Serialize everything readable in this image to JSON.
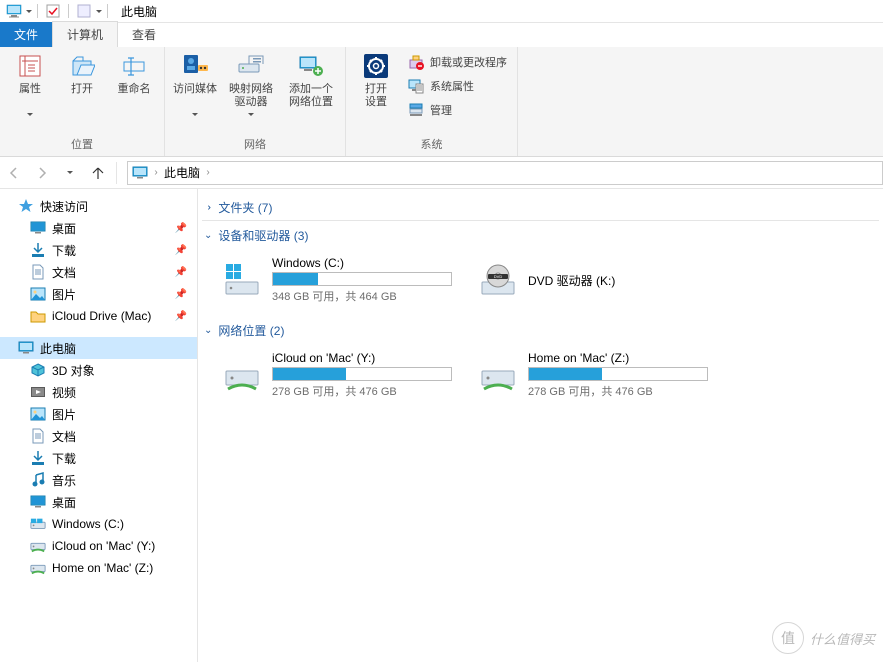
{
  "title": "此电脑",
  "tabs": {
    "file": "文件",
    "computer": "计算机",
    "view": "查看"
  },
  "ribbon": {
    "location": {
      "label": "位置",
      "properties": "属性",
      "open": "打开",
      "rename": "重命名"
    },
    "network": {
      "label": "网络",
      "accessMedia": "访问媒体",
      "mapDrive": "映射网络\n驱动器",
      "addLocation": "添加一个\n网络位置"
    },
    "system": {
      "label": "系统",
      "openSettings": "打开\n设置",
      "uninstall": "卸载或更改程序",
      "sysProps": "系统属性",
      "manage": "管理"
    }
  },
  "breadcrumb": {
    "root": "此电脑"
  },
  "nav": {
    "quickAccess": "快速访问",
    "pinned": [
      {
        "label": "桌面",
        "icon": "desktop"
      },
      {
        "label": "下载",
        "icon": "download"
      },
      {
        "label": "文档",
        "icon": "document"
      },
      {
        "label": "图片",
        "icon": "picture"
      },
      {
        "label": "iCloud Drive (Mac)",
        "icon": "folder"
      }
    ],
    "thisPC": "此电脑",
    "pcItems": [
      {
        "label": "3D 对象",
        "icon": "3d"
      },
      {
        "label": "视频",
        "icon": "video"
      },
      {
        "label": "图片",
        "icon": "picture"
      },
      {
        "label": "文档",
        "icon": "document"
      },
      {
        "label": "下载",
        "icon": "download"
      },
      {
        "label": "音乐",
        "icon": "music"
      },
      {
        "label": "桌面",
        "icon": "desktop"
      },
      {
        "label": "Windows (C:)",
        "icon": "drive"
      },
      {
        "label": "iCloud on 'Mac' (Y:)",
        "icon": "netdrive"
      },
      {
        "label": "Home on 'Mac' (Z:)",
        "icon": "netdrive"
      }
    ]
  },
  "content": {
    "folders": {
      "label": "文件夹",
      "count": 7
    },
    "devices": {
      "label": "设备和驱动器",
      "count": 3,
      "items": [
        {
          "name": "Windows (C:)",
          "icon": "osdrive",
          "used": 25,
          "sub": "348 GB 可用，共 464 GB"
        },
        {
          "name": "DVD 驱动器 (K:)",
          "icon": "dvd",
          "noBar": true
        }
      ]
    },
    "netloc": {
      "label": "网络位置",
      "count": 2,
      "items": [
        {
          "name": "iCloud on 'Mac' (Y:)",
          "icon": "netdrive",
          "used": 41,
          "sub": "278 GB 可用，共 476 GB"
        },
        {
          "name": "Home on 'Mac' (Z:)",
          "icon": "netdrive",
          "used": 41,
          "sub": "278 GB 可用，共 476 GB"
        }
      ]
    }
  },
  "watermark": "什么值得买"
}
